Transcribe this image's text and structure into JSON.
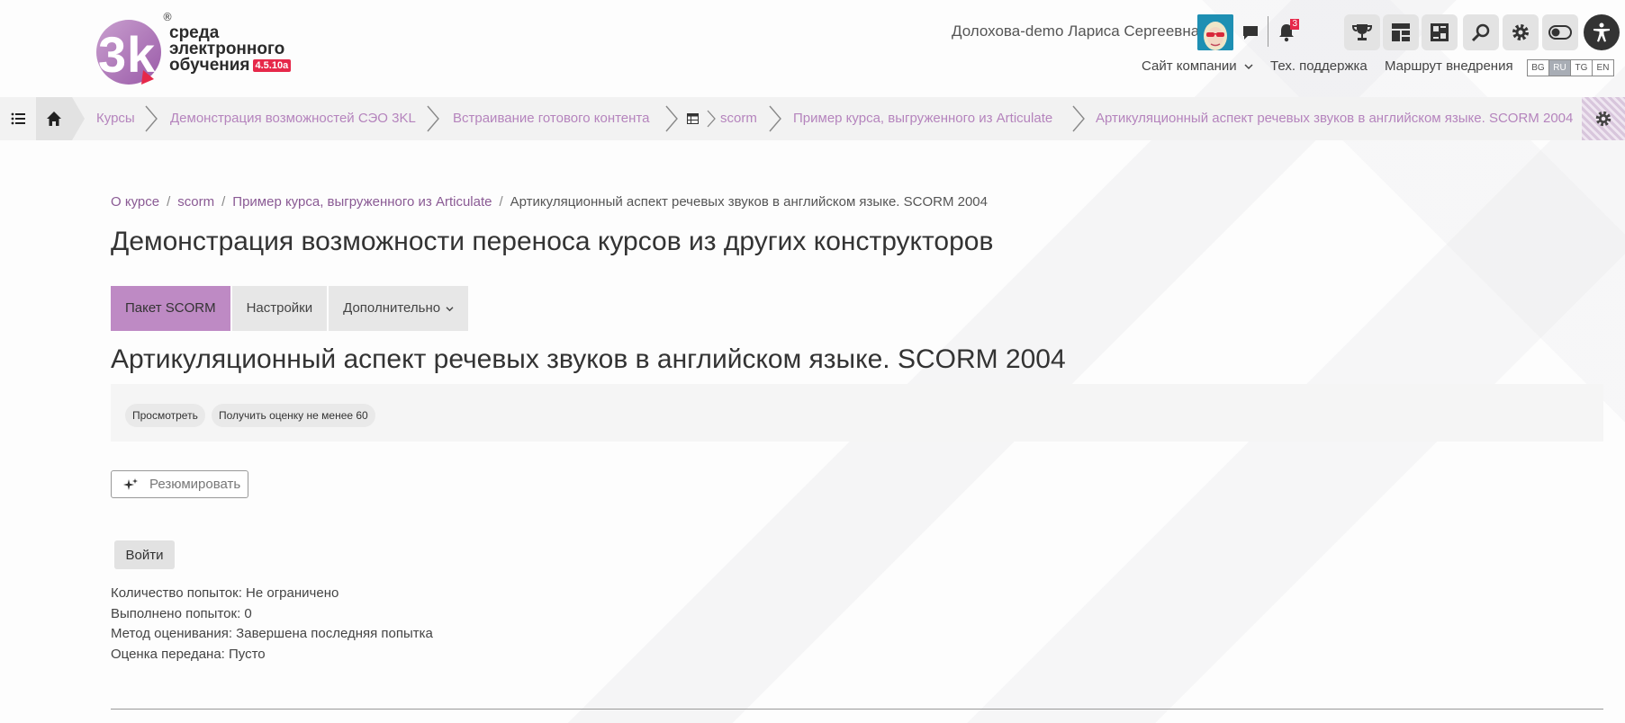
{
  "brand": {
    "line1": "среда",
    "line2": "электронного",
    "line3": "обучения",
    "version": "4.5.10a",
    "registered": "®"
  },
  "user": {
    "name": "Долохова-demo Лариса Сергеевна",
    "notifications_count": "3"
  },
  "top_links": {
    "company_site": "Сайт компании",
    "support": "Тех. поддержка",
    "route": "Маршрут внедрения"
  },
  "languages": [
    "BG",
    "RU",
    "TG",
    "EN"
  ],
  "active_language": "RU",
  "breadcrumbs": [
    "Курсы",
    "Демонстрация возможностей СЭО 3KL",
    "Встраивание готового контента",
    "scorm",
    "Пример курса, выгруженного из Articulate",
    "Артикуляционный аспект речевых звуков в английском языке. SCORM 2004"
  ],
  "sub_breadcrumbs": {
    "about": "О курсе",
    "scorm": "scorm",
    "course_example": "Пример курса, выгруженного из Articulate",
    "current": "Артикуляционный аспект речевых звуков в английском языке. SCORM 2004",
    "separator": "/"
  },
  "page_title": "Демонстрация возможности переноса курсов из других конструкторов",
  "tabs": {
    "package": "Пакет SCORM",
    "settings": "Настройки",
    "more": "Дополнительно"
  },
  "content_title": "Артикуляционный аспект речевых звуков в английском языке. SCORM 2004",
  "completion": {
    "view": "Просмотреть",
    "grade": "Получить оценку не менее 60"
  },
  "summarize_label": "Резюмировать",
  "enter_label": "Войти",
  "info": {
    "attempts": "Количество попыток: Не ограничено",
    "done": "Выполнено попыток: 0",
    "method": "Метод оценивания: Завершена последняя попытка",
    "grade": "Оценка передана: Пусто"
  },
  "colors": {
    "accent": "#be8ac4",
    "crumb": "#b584bd",
    "brand_red": "#e6284a"
  },
  "icons": [
    "list-icon",
    "home-icon",
    "message-icon",
    "bell-icon",
    "trophy-icon",
    "dashboard-icon",
    "grid-icon",
    "search-icon",
    "gear-icon",
    "toggle-icon",
    "accessibility-icon",
    "table-icon",
    "sparkle-icon",
    "chevron-down-icon"
  ]
}
